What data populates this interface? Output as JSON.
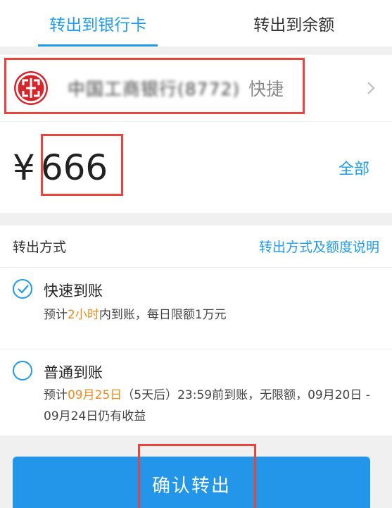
{
  "tabs": [
    {
      "label": "转出到银行卡",
      "active": true
    },
    {
      "label": "转出到余额",
      "active": false
    }
  ],
  "bank": {
    "name_obscured": "中国工商银行(8772)",
    "tag": "快捷",
    "logo_icon": "icbc-logo-icon",
    "chevron_icon": "chevron-right-icon"
  },
  "amount": {
    "currency": "¥",
    "value": "666",
    "all_label": "全部"
  },
  "method": {
    "label": "转出方式",
    "link": "转出方式及额度说明"
  },
  "options": {
    "fast": {
      "title": "快速到账",
      "desc_pre": "预计",
      "desc_hl": "2小时",
      "desc_post": "内到账，每日限额1万元",
      "selected": true
    },
    "normal": {
      "title": "普通到账",
      "desc_pre": "预计",
      "desc_hl": "09月25日",
      "desc_post": "（5天后）23:59前到账，无限额，09月20日 - 09月24日仍有收益",
      "selected": false
    }
  },
  "confirm_label": "确认转出",
  "colors": {
    "accent": "#1e9bea",
    "highlight": "#f08a1c",
    "bank_red": "#d6262b",
    "annotation_red": "#e8453c"
  }
}
